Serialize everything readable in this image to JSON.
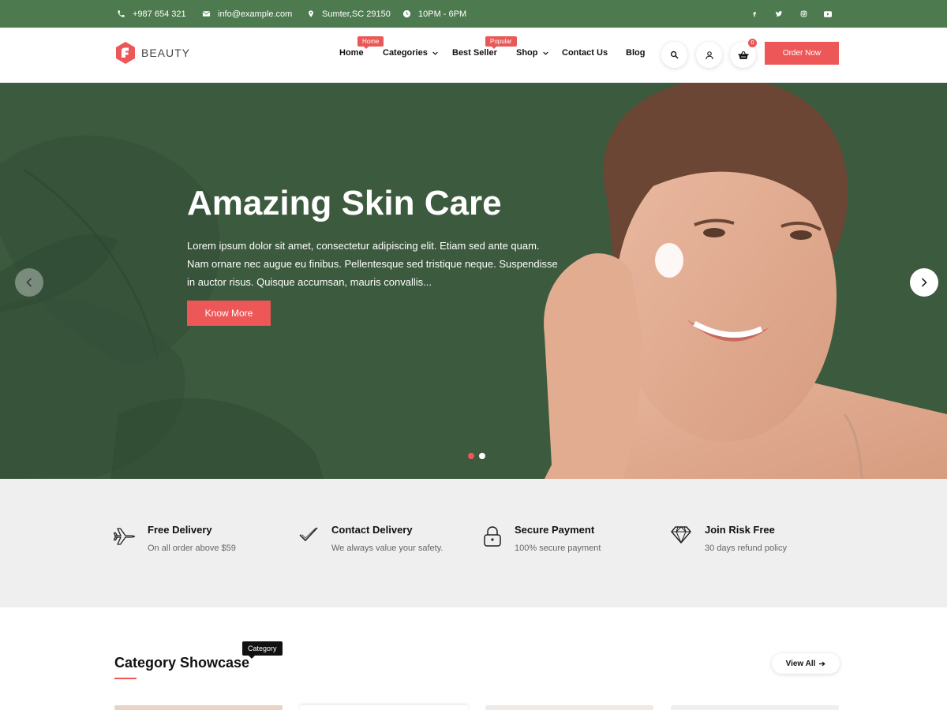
{
  "topbar": {
    "phone": "+987 654 321",
    "email": "info@example.com",
    "location": "Sumter,SC 29150",
    "hours": "10PM - 6PM",
    "social_icons": [
      "facebook-icon",
      "twitter-icon",
      "instagram-icon",
      "youtube-icon"
    ]
  },
  "header": {
    "logo_text": "BEAUTY",
    "nav": [
      {
        "label": "Home",
        "badge": "Home"
      },
      {
        "label": "Categories"
      },
      {
        "label": "Best Seller",
        "badge": "Popular"
      },
      {
        "label": "Shop"
      },
      {
        "label": "Contact Us"
      },
      {
        "label": "Blog"
      }
    ],
    "cart_count": "0",
    "order_button": "Order Now"
  },
  "hero": {
    "title": "Amazing Skin Care",
    "text": "Lorem ipsum dolor sit amet, consectetur adipiscing elit. Etiam sed ante quam. Nam ornare nec augue eu finibus. Pellentesque sed tristique neque. Suspendisse in auctor risus. Quisque accumsan, mauris convallis...",
    "button": "Know More",
    "slides": 2,
    "active_slide": 1
  },
  "features": [
    {
      "icon": "airplane-icon",
      "title": "Free Delivery",
      "subtitle": "On all order above $59"
    },
    {
      "icon": "check-icon",
      "title": "Contact Delivery",
      "subtitle": "We always value your safety."
    },
    {
      "icon": "lock-icon",
      "title": "Secure Payment",
      "subtitle": "100% secure payment"
    },
    {
      "icon": "diamond-icon",
      "title": "Join Risk Free",
      "subtitle": "30 days refund policy"
    }
  ],
  "category": {
    "title": "Category Showcase",
    "badge": "Category",
    "view_all": "View All"
  },
  "colors": {
    "accent": "#ee5757",
    "topbar_green": "#4e7a4f",
    "hero_green": "#3c5a3d",
    "features_bg": "#efefef"
  }
}
